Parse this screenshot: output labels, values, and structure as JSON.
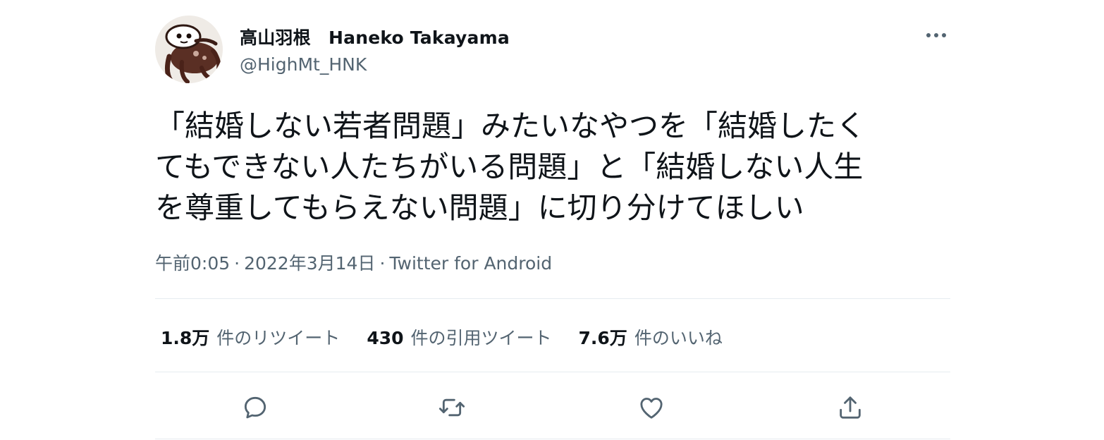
{
  "author": {
    "name": "高山羽根　Haneko Takayama",
    "handle": "@HighMt_HNK"
  },
  "tweet": {
    "text": "「結婚しない若者問題」みたいなやつを「結婚したく\nてもできない人たちがいる問題」と「結婚しない人生\nを尊重してもらえない問題」に切り分けてほしい"
  },
  "meta": {
    "time": "午前0:05",
    "separator": "·",
    "date": "2022年3月14日",
    "source": "Twitter for Android"
  },
  "stats": {
    "retweets_count": "1.8万",
    "retweets_label": "件のリツイート",
    "quotes_count": "430",
    "quotes_label": "件の引用ツイート",
    "likes_count": "7.6万",
    "likes_label": "件のいいね"
  },
  "icons": {
    "more": "more-horizontal-icon",
    "reply": "reply-icon",
    "retweet": "retweet-icon",
    "like": "heart-icon",
    "share": "share-icon"
  },
  "colors": {
    "text": "#0f1419",
    "secondary": "#536471",
    "divider": "#e6ecf0"
  }
}
